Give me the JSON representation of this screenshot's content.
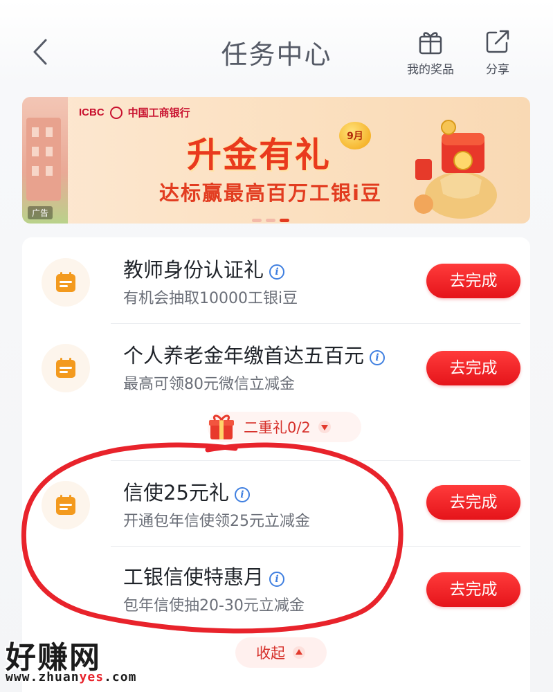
{
  "header": {
    "title": "任务中心",
    "my_prizes_label": "我的奖品",
    "share_label": "分享"
  },
  "banner": {
    "bank_en": "ICBC",
    "bank_cn": "中国工商银行",
    "title": "升金有礼",
    "month": "9月",
    "subtitle": "达标赢最高百万工银i豆",
    "ad_tag": "广告"
  },
  "tasks": [
    {
      "title": "教师身份认证礼",
      "desc": "有机会抽取10000工银i豆",
      "button": "去完成"
    },
    {
      "title": "个人养老金年缴首达五百元",
      "desc": "最高可领80元微信立减金",
      "button": "去完成"
    },
    {
      "title": "信使25元礼",
      "desc": "开通包年信使领25元立减金",
      "button": "去完成"
    },
    {
      "title": "工银信使特惠月",
      "desc": "包年信使抽20-30元立减金",
      "button": "去完成"
    }
  ],
  "double_gift": {
    "label": "二重礼0/2"
  },
  "collapse": {
    "label": "收起"
  },
  "watermark": {
    "cn": "好赚网",
    "en_prefix": "www.zhuan",
    "en_hl": "yes",
    "en_suffix": ".com"
  },
  "colors": {
    "accent": "#e5141a",
    "annotation": "#e8232b",
    "task_icon": "#f39a1e"
  }
}
